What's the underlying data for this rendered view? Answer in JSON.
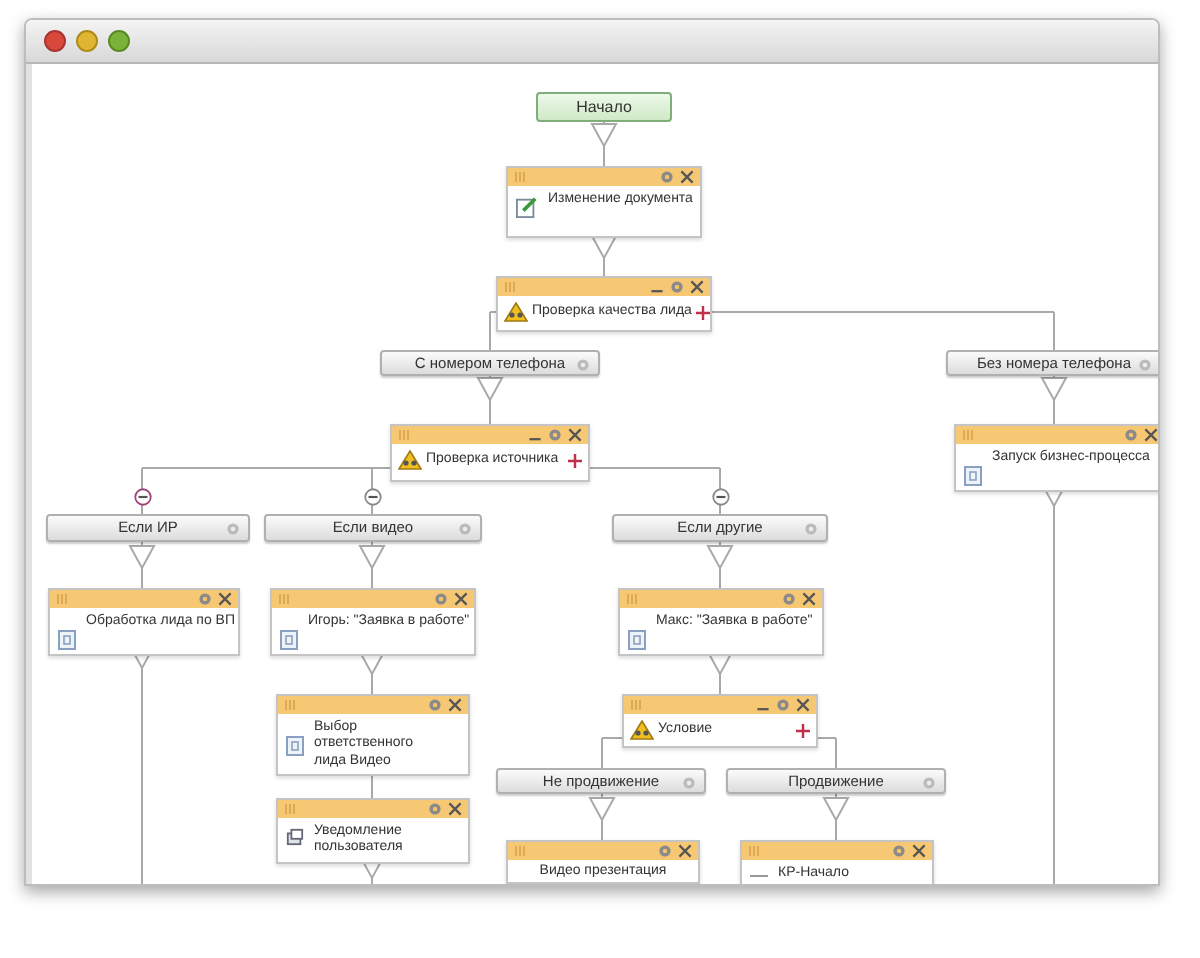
{
  "diagram": {
    "nodes": [
      {
        "kind": "start",
        "label": "Начало"
      },
      {
        "kind": "action",
        "label": "Изменение документа"
      },
      {
        "kind": "condition",
        "label": "Проверка качества лида"
      },
      {
        "kind": "branch",
        "label": "С номером телефона"
      },
      {
        "kind": "branch",
        "label": "Без номера телефона"
      },
      {
        "kind": "condition",
        "label": "Проверка источника"
      },
      {
        "kind": "action",
        "label": "Запуск бизнес-процесса"
      },
      {
        "kind": "branch",
        "label": "Если ИР"
      },
      {
        "kind": "branch",
        "label": "Если видео"
      },
      {
        "kind": "branch",
        "label": "Если другие"
      },
      {
        "kind": "action",
        "label": "Обработка лида по ВП"
      },
      {
        "kind": "action",
        "label": "Игорь: \"Заявка в работе\""
      },
      {
        "kind": "action",
        "label": "Макс: \"Заявка в работе\""
      },
      {
        "kind": "action",
        "label": "Выбор ответственного лида Видео"
      },
      {
        "kind": "condition",
        "label": "Условие"
      },
      {
        "kind": "action",
        "label": "Уведомление пользователя"
      },
      {
        "kind": "branch",
        "label": "Не продвижение"
      },
      {
        "kind": "branch",
        "label": "Продвижение"
      },
      {
        "kind": "action",
        "label": "Видео презентация"
      },
      {
        "kind": "action",
        "label": "КР-Начало"
      }
    ]
  }
}
